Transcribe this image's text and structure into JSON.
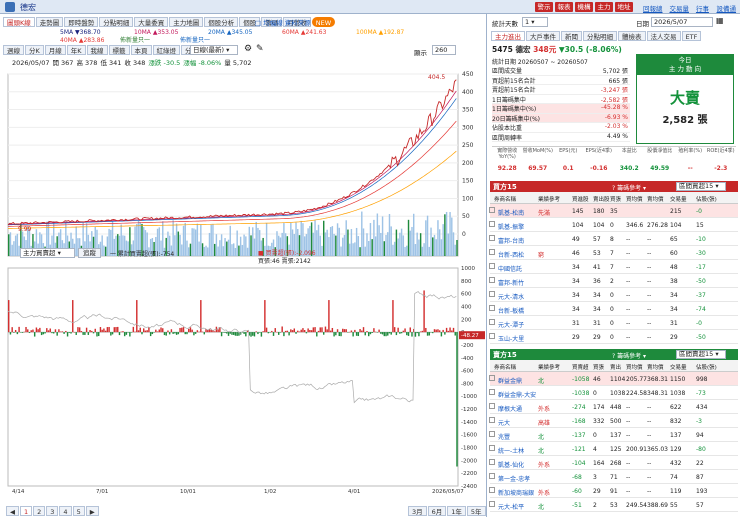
{
  "window": {
    "title": "德宏"
  },
  "top_buttons": [
    "警示",
    "報表",
    "機構",
    "主力",
    "地址"
  ],
  "top_links": [
    "回報總表",
    "交易量價",
    "行事曆",
    "設備通知"
  ],
  "left_tabs": {
    "active": "圖頭K線",
    "items": [
      "走勢圖",
      "即時盤勢",
      "分點明細",
      "大量委買",
      "主力地圖",
      "個股分析",
      "個股",
      "籌碼",
      "月營收"
    ],
    "badge": "NEW"
  },
  "ma_legend": [
    {
      "label": "5MA ▼368.70",
      "color": "#1a237e"
    },
    {
      "label": "10MA ▲353.05",
      "color": "#c2185b"
    },
    {
      "label": "20MA ▲345.05",
      "color": "#1565c0"
    },
    {
      "label": "60MA ▲241.63",
      "color": "#e53935"
    },
    {
      "label": "100MA ▲192.87",
      "color": "#ffa000"
    },
    {
      "label": "40MA ▲283.86",
      "color": "#e53935"
    },
    {
      "label": "佈新量只一",
      "color": "#2e7d32"
    },
    {
      "label": "佈新量只一",
      "color": "#1565c0"
    }
  ],
  "legend_link": "□ 均幅線 資料來源",
  "tool_tabs": [
    "週線",
    "分K",
    "月線",
    "年K",
    "我線",
    "標籤",
    "本頁",
    "紅綠燈",
    "分量",
    "指標"
  ],
  "tool_select": "日線(最新)",
  "count_label": "顯示",
  "count_value": "260",
  "ohlc_line": {
    "date": "2026/05/07",
    "open": "開 367",
    "high": "高 378",
    "low": "低 341",
    "close": "收 348",
    "change": "漲跌 -30.5",
    "pct": "漲幅 -8.06%",
    "vol": "量 5,702"
  },
  "price_axis": [
    "450",
    "400",
    "350",
    "300",
    "250",
    "200",
    "150",
    "100",
    "50",
    "0"
  ],
  "peak_label": "404.5",
  "low_label": "9.99",
  "lower_select": "主力買賣超",
  "lower_button": "追蹤",
  "lower_legend": {
    "line1": "一 累計買賣超(張):-754",
    "buy_sell": "■ 買賣超(張):-2,096",
    "detail": "買張:46 賣張:2142"
  },
  "lower_axis": [
    "1000",
    "800",
    "600",
    "400",
    "200",
    "0",
    "-200",
    "-400",
    "-600",
    "-800",
    "-1000",
    "-1200",
    "-1400",
    "-1600",
    "-1800",
    "-2000",
    "-2200",
    "-2400"
  ],
  "lower_current": "-48.27",
  "x_axis": [
    {
      "label": "4/14",
      "sub": "2025"
    },
    {
      "label": "7/01",
      "sub": ""
    },
    {
      "label": "10/01",
      "sub": ""
    },
    {
      "label": "1/02",
      "sub": "2026"
    },
    {
      "label": "4/01",
      "sub": ""
    },
    {
      "label": "2026/05/07",
      "sub": ""
    }
  ],
  "pager": {
    "pages": [
      "1",
      "2",
      "3",
      "4",
      "5"
    ],
    "periods": [
      "3月",
      "6月",
      "1年",
      "5年"
    ]
  },
  "right_header": {
    "days_label": "統計天數",
    "days_value": "1",
    "date_label": "日期",
    "date_value": "2026/5/07"
  },
  "right_tabs": [
    "主力進出",
    "大戶事件",
    "新聞",
    "分點明細",
    "體檢表",
    "法人交易",
    "ETF"
  ],
  "stock": {
    "code_name": "5475 德宏",
    "price": "348元",
    "change": "▼30.5 (-8.06%)"
  },
  "summary": {
    "range": "統計日期 20260507 ~ 20260507",
    "rows": [
      {
        "k": "區間成交量",
        "v": "5,702 張"
      },
      {
        "k": "買超前15名合計",
        "v": "665 張"
      },
      {
        "k": "賣超前15名合計",
        "v": "-3,247 張"
      },
      {
        "k": "1日籌碼集中",
        "v": "-2,582 張"
      },
      {
        "k": "1日籌碼集中(%)",
        "v": "-45.28 %"
      },
      {
        "k": "20日籌碼集中(%)",
        "v": "-6.93 %"
      },
      {
        "k": "佔股本比重",
        "v": "-2.03 %"
      },
      {
        "k": "區間周轉率",
        "v": "4.49 %"
      }
    ]
  },
  "verdict": {
    "title": "今日",
    "sub": "主 力 動 向",
    "label": "大賣",
    "qty": "2,582 張"
  },
  "fin": {
    "heads": [
      "實際營收YoY(%)",
      "營收MoM(%)",
      "EPS(元)",
      "EPS(近4季)",
      "本益比",
      "股價淨值比",
      "殖利率(%)",
      "ROE(近4季)"
    ],
    "vals": [
      "92.28",
      "69.57",
      "0.1",
      "-0.16",
      "340.2",
      "49.59",
      "--",
      "-2.3"
    ]
  },
  "buy_panel": {
    "title": "買方15",
    "filter": "籌碼參考",
    "select": "區間買超15",
    "cols": [
      "券商名稱",
      "業績參考",
      "買進股",
      "賣出股",
      "買張",
      "買均價",
      "賣均價",
      "交易量",
      "佔股(張)"
    ],
    "rows": [
      [
        "凱基-松南",
        "先滿",
        "145",
        "180",
        "35",
        "",
        "",
        "215",
        "-0"
      ],
      [
        "凱基-振擎",
        "",
        "104",
        "104",
        "0",
        "346.6",
        "276.28",
        "104",
        "15"
      ],
      [
        "富邦-台南",
        "",
        "49",
        "57",
        "8",
        "--",
        "--",
        "65",
        "-10"
      ],
      [
        "台新-西松",
        "窮",
        "46",
        "53",
        "7",
        "--",
        "--",
        "60",
        "-30"
      ],
      [
        "中國信託",
        "",
        "34",
        "41",
        "7",
        "--",
        "--",
        "48",
        "-17"
      ],
      [
        "富邦-新竹",
        "",
        "34",
        "36",
        "2",
        "--",
        "--",
        "38",
        "-50"
      ],
      [
        "元大-清水",
        "",
        "34",
        "34",
        "0",
        "--",
        "--",
        "34",
        "-37"
      ],
      [
        "台新-板橋",
        "",
        "34",
        "34",
        "0",
        "--",
        "--",
        "34",
        "-74"
      ],
      [
        "元大-潭子",
        "",
        "31",
        "31",
        "0",
        "--",
        "--",
        "31",
        "-0"
      ],
      [
        "玉山-大里",
        "",
        "29",
        "29",
        "0",
        "--",
        "--",
        "29",
        "-50"
      ]
    ]
  },
  "sell_panel": {
    "title": "賣方15",
    "filter": "籌碼參考",
    "select": "區間賣超15",
    "cols": [
      "券商名稱",
      "業績參考",
      "買賣超",
      "買張",
      "賣出",
      "買均價",
      "賣均價",
      "交易量",
      "佔股(張)"
    ],
    "rows": [
      [
        "群益金鼎",
        "北",
        "-1058",
        "46",
        "1104",
        "205.77",
        "368.31",
        "1150",
        "998"
      ],
      [
        "群益金鼎-大安",
        "",
        "-1038",
        "0",
        "1038",
        "224.58",
        "348.31",
        "1038",
        "-73"
      ],
      [
        "摩根大通",
        "外系",
        "-274",
        "174",
        "448",
        "--",
        "--",
        "622",
        "434"
      ],
      [
        "元大",
        "高雄",
        "-168",
        "332",
        "500",
        "--",
        "--",
        "832",
        "-3"
      ],
      [
        "兆豐",
        "北",
        "-137",
        "0",
        "137",
        "--",
        "--",
        "137",
        "94"
      ],
      [
        "統一-土林",
        "北",
        "-121",
        "4",
        "125",
        "200.91",
        "365.03",
        "129",
        "-80"
      ],
      [
        "凱基-仙化",
        "外系",
        "-104",
        "164",
        "268",
        "--",
        "--",
        "432",
        "22"
      ],
      [
        "第一金-忠孝",
        "",
        "-68",
        "3",
        "71",
        "--",
        "--",
        "74",
        "87"
      ],
      [
        "新加坡商瑞銀",
        "外系",
        "-60",
        "29",
        "91",
        "--",
        "--",
        "119",
        "193"
      ],
      [
        "元大-松平",
        "北",
        "-51",
        "2",
        "53",
        "249.54",
        "388.69",
        "55",
        "57"
      ]
    ]
  }
}
